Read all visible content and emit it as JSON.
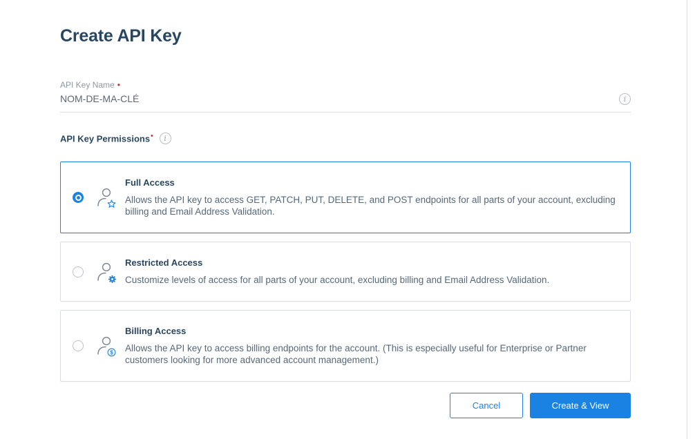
{
  "page": {
    "title": "Create API Key"
  },
  "colors": {
    "accent_blue": "#1A82E2",
    "heading": "#294661",
    "body_text": "#55687A",
    "label_gray": "#8C98A4",
    "border_gray": "#D8DEE4",
    "required_red": "#BE2C30"
  },
  "form": {
    "name_field": {
      "label": "API Key Name",
      "required_marker": "•",
      "value": "NOM-DE-MA-CLÉ",
      "info_icon": "info-circle-icon"
    },
    "permissions": {
      "label": "API Key Permissions",
      "required_marker": "•",
      "info_icon": "info-circle-icon",
      "options": [
        {
          "title": "Full Access",
          "description": "Allows the API key to access GET, PATCH, PUT, DELETE, and POST endpoints for all parts of your account, excluding billing and Email Address Validation.",
          "selected": true,
          "icon": "user-star-icon"
        },
        {
          "title": "Restricted Access",
          "description": "Customize levels of access for all parts of your account, excluding billing and Email Address Validation.",
          "selected": false,
          "icon": "user-gear-icon"
        },
        {
          "title": "Billing Access",
          "description": "Allows the API key to access billing endpoints for the account. (This is especially useful for Enterprise or Partner customers looking for more advanced account management.)",
          "selected": false,
          "icon": "user-dollar-icon"
        }
      ]
    }
  },
  "actions": {
    "cancel_label": "Cancel",
    "create_label": "Create & View"
  }
}
